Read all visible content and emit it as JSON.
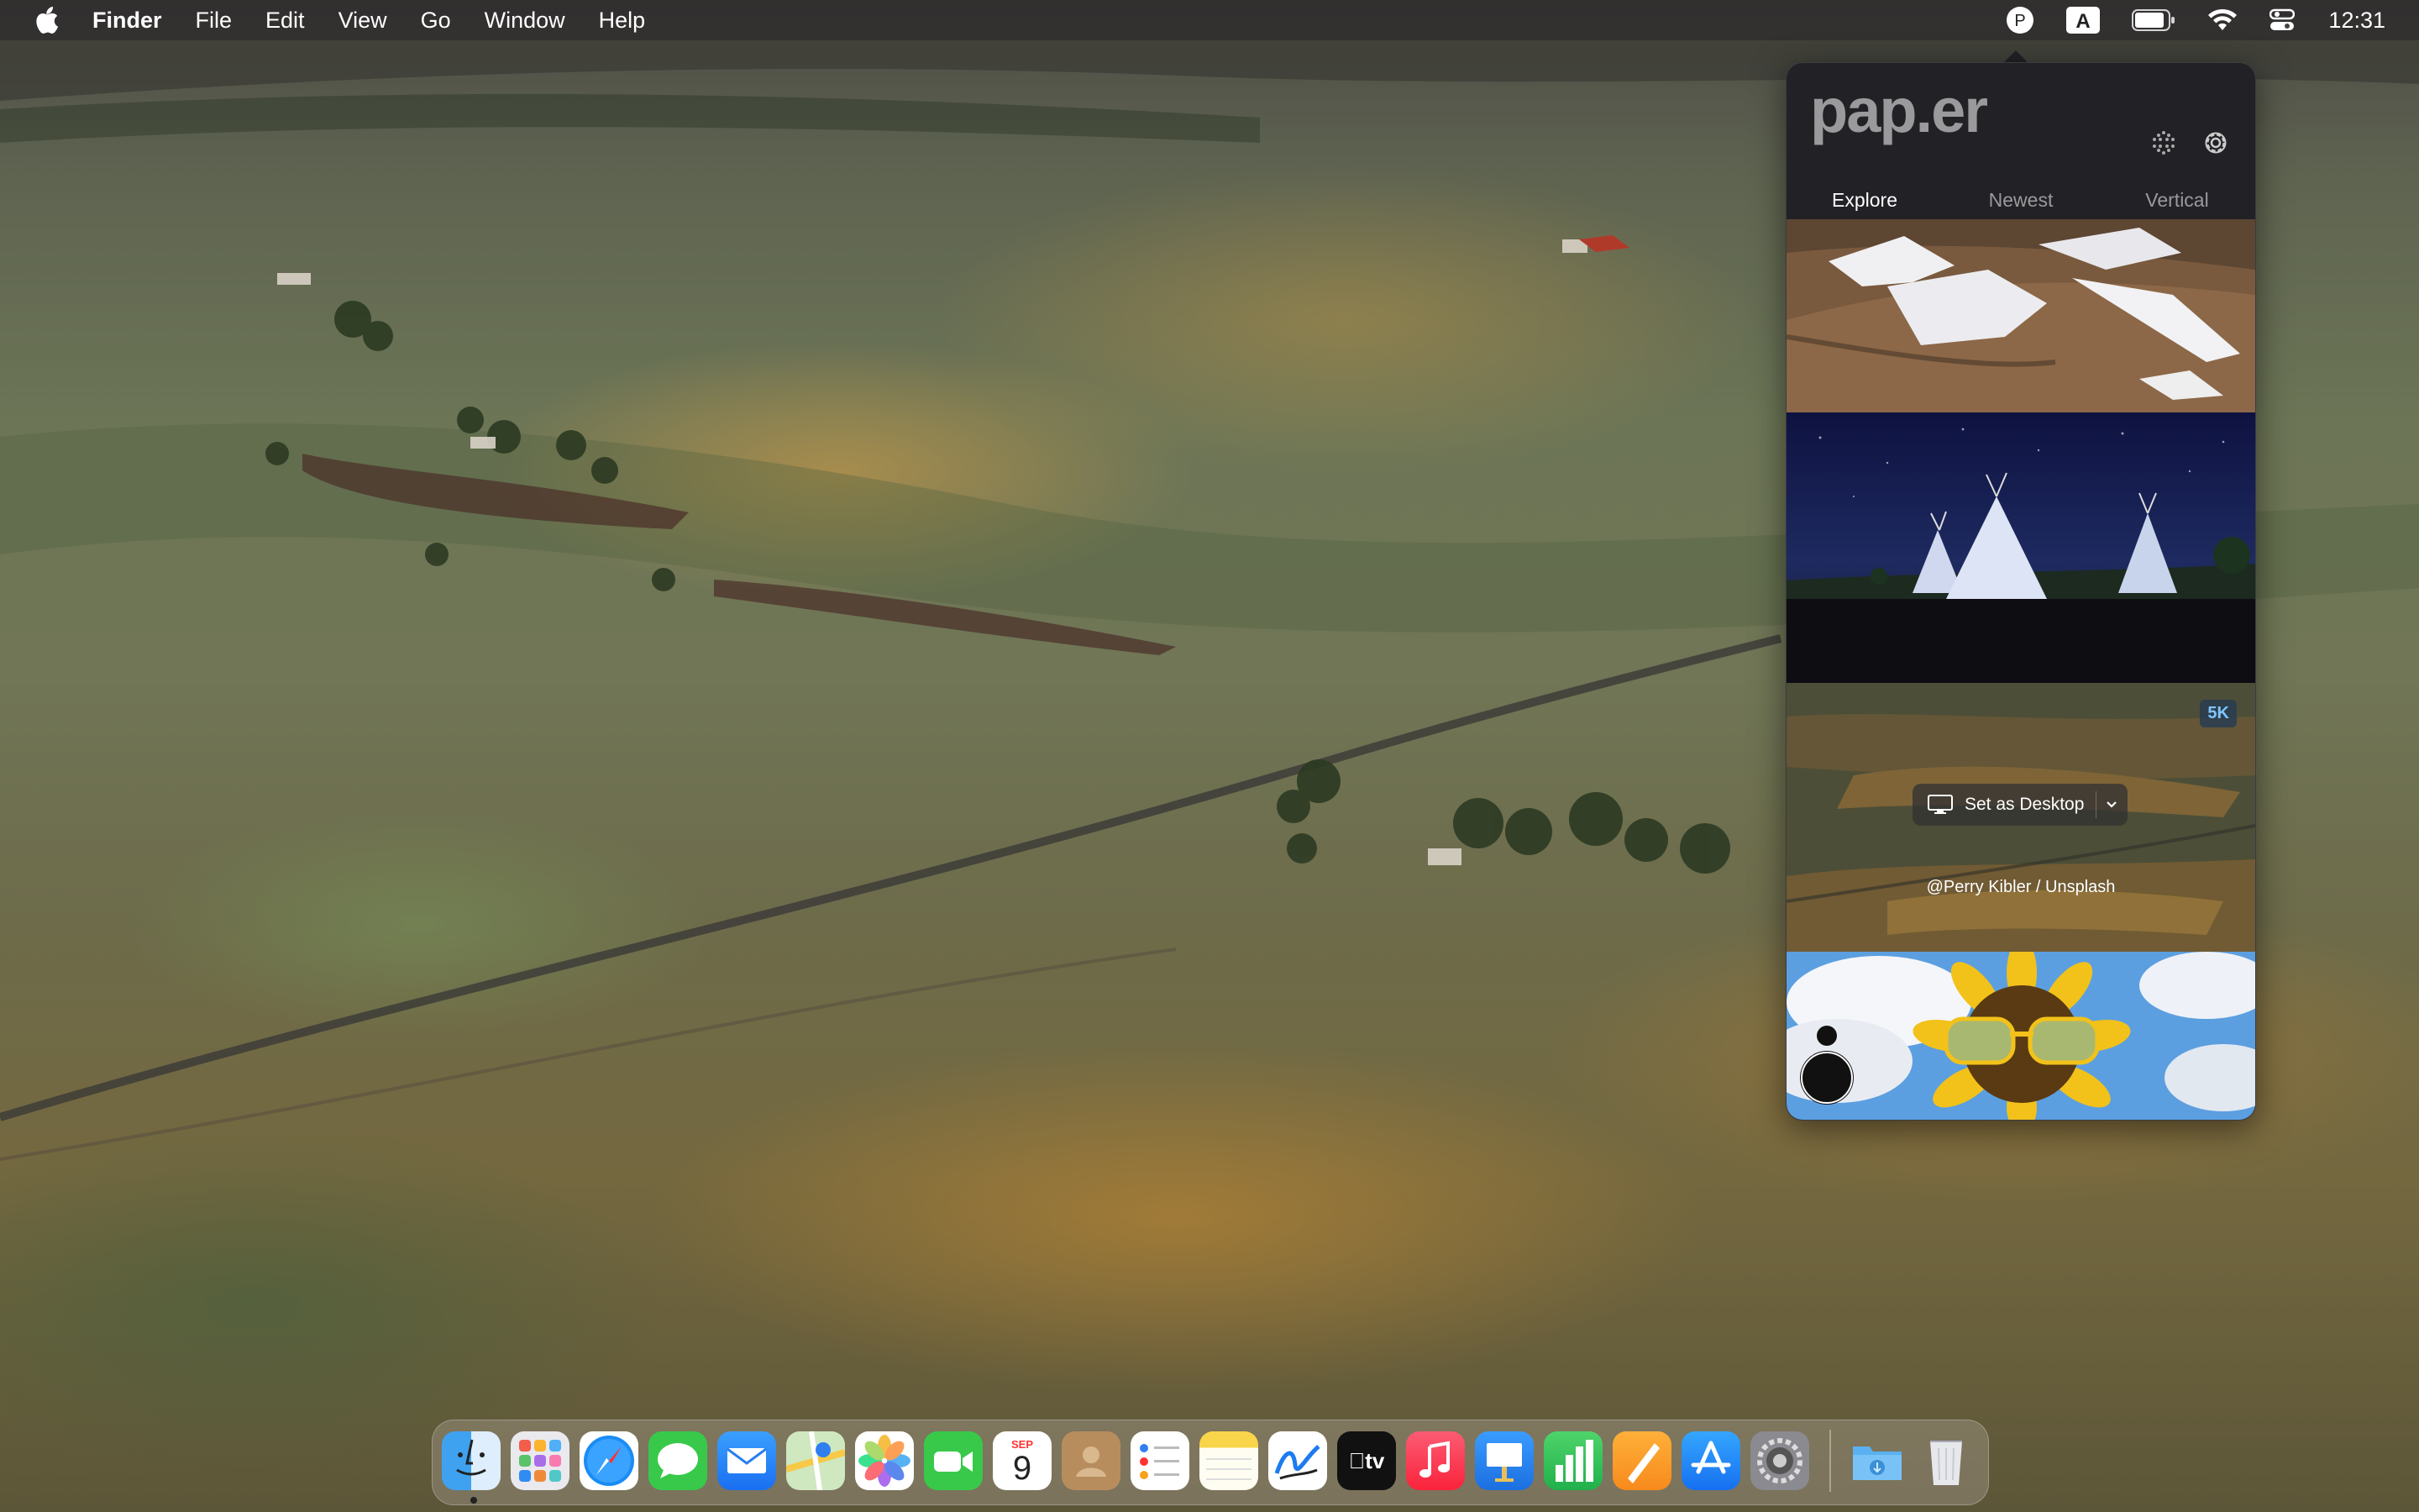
{
  "menubar": {
    "app_name": "Finder",
    "menus": [
      "File",
      "Edit",
      "View",
      "Go",
      "Window",
      "Help"
    ],
    "status_icons": [
      "paper-app-icon",
      "keyboard-input-a-icon",
      "battery-icon",
      "wifi-icon",
      "control-center-icon"
    ],
    "input_source": "A",
    "app_status_letter": "P",
    "clock": "12:31"
  },
  "popover": {
    "logo": "pap.er",
    "tabs": [
      "Explore",
      "Newest",
      "Vertical"
    ],
    "active_tab": "Explore",
    "thumbnails": [
      {
        "name": "snowy-hills"
      },
      {
        "name": "teepees-night"
      },
      {
        "name": "palouse-hills",
        "badge": "5K",
        "action_label": "Set as Desktop",
        "credit": "@Perry Kibler / Unsplash"
      },
      {
        "name": "sunflower-sunglasses"
      }
    ]
  },
  "dock": {
    "apps": [
      "Finder",
      "Launchpad",
      "Safari",
      "Messages",
      "Mail",
      "Maps",
      "Photos",
      "FaceTime",
      "Calendar",
      "Contacts",
      "Reminders",
      "Notes",
      "Freeform",
      "TV",
      "Music",
      "Keynote",
      "Numbers",
      "Pages",
      "App Store",
      "System Settings",
      "Downloads",
      "Trash"
    ],
    "calendar_month": "SEP",
    "calendar_day": "9",
    "tv_label": "tv"
  },
  "colors": {
    "accent_blue": "#7fc6ff",
    "popover_bg": "#222226"
  }
}
